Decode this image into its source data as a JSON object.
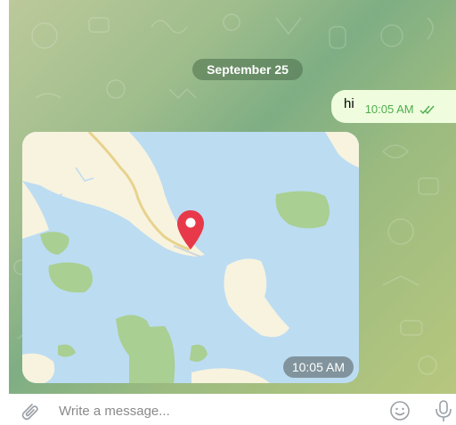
{
  "chat": {
    "date_separator": "September 25",
    "outgoing_message": {
      "text": "hi",
      "time": "10:05 AM",
      "status_icon": "double-check-icon"
    },
    "location_message": {
      "time": "10:05 AM",
      "pin_icon": "map-pin-icon"
    }
  },
  "composer": {
    "placeholder": "Write a message...",
    "attach_icon": "paperclip-icon",
    "emoji_icon": "emoji-icon",
    "mic_icon": "microphone-icon"
  },
  "colors": {
    "outgoing_bubble": "#effdde",
    "read_check": "#4fae4e",
    "map_water": "#bcdcf2",
    "map_land": "#f7f3df",
    "map_park": "#a9cf92",
    "pin": "#e8394a"
  }
}
